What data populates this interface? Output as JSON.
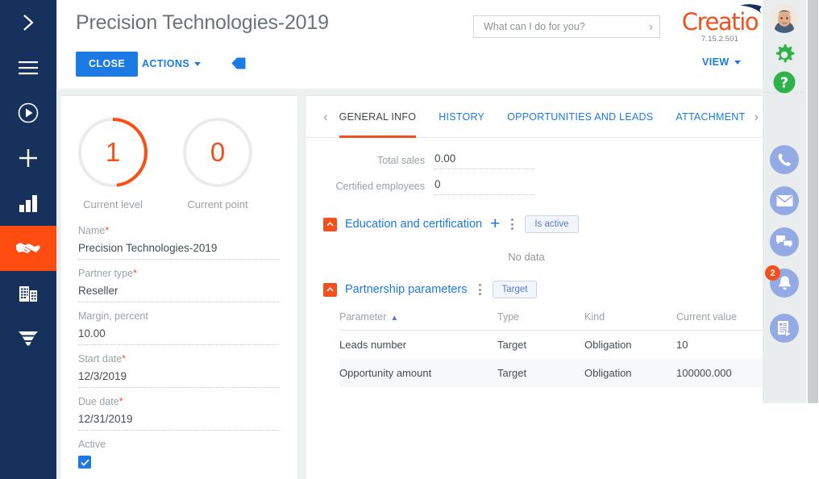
{
  "left_nav": {
    "items": [
      {
        "name": "expand-icon",
        "label": "Expand menu"
      },
      {
        "name": "hamburger-icon",
        "label": "Main menu"
      },
      {
        "name": "run-process-icon",
        "label": "Run process"
      },
      {
        "name": "add-icon",
        "label": "Add"
      },
      {
        "name": "analytics-icon",
        "label": "Dashboards"
      },
      {
        "name": "partners-icon",
        "label": "Partners",
        "active": true
      },
      {
        "name": "accounts-icon",
        "label": "Accounts"
      },
      {
        "name": "funnel-icon",
        "label": "Sales pipeline"
      }
    ]
  },
  "header": {
    "title": "Precision Technologies-2019",
    "close_label": "CLOSE",
    "actions_label": "ACTIONS",
    "view_label": "VIEW",
    "tag_icon": "tag-icon",
    "search": {
      "placeholder": "What can I do for you?",
      "value": "",
      "submit_icon": "chevron-right-icon"
    },
    "brand": {
      "name": "Creatio",
      "version": "7.15.2.501",
      "color": "#f4501e"
    }
  },
  "profile": {
    "gauges": [
      {
        "value": "1",
        "label": "Current level",
        "percent": 48,
        "color": "#ff4d12"
      },
      {
        "value": "0",
        "label": "Current point",
        "percent": 0,
        "color": "#ff4d12"
      }
    ],
    "fields": [
      {
        "label": "Name",
        "required": true,
        "value": "Precision Technologies-2019",
        "type": "text"
      },
      {
        "label": "Partner type",
        "required": true,
        "value": "Reseller",
        "type": "text"
      },
      {
        "label": "Margin, percent",
        "required": false,
        "value": "10.00",
        "type": "text"
      },
      {
        "label": "Start date",
        "required": true,
        "value": "12/3/2019",
        "type": "text"
      },
      {
        "label": "Due date",
        "required": true,
        "value": "12/31/2019",
        "type": "text"
      },
      {
        "label": "Active",
        "required": false,
        "value": "",
        "type": "checkbox",
        "checked": true
      }
    ]
  },
  "main": {
    "tabs": [
      {
        "label": "GENERAL INFO",
        "active": true
      },
      {
        "label": "HISTORY",
        "active": false
      },
      {
        "label": "OPPORTUNITIES AND LEADS",
        "active": false
      },
      {
        "label": "ATTACHMENTS",
        "active": false
      }
    ],
    "prev_tab_icon": "chevron-left-icon",
    "next_tab_icon": "chevron-right-icon",
    "general_info": [
      {
        "label": "Total sales",
        "value": "0.00"
      },
      {
        "label": "Certified employees",
        "value": "0"
      }
    ],
    "sections": [
      {
        "title": "Education and certification",
        "collapse_icon": "chevron-up-icon",
        "add_icon": "plus-icon",
        "menu_icon": "kebab-menu-icon",
        "chip": "Is active",
        "empty_text": "No data",
        "has_add": true
      },
      {
        "title": "Partnership parameters",
        "collapse_icon": "chevron-up-icon",
        "menu_icon": "kebab-menu-icon",
        "chip": "Target",
        "has_add": false
      }
    ],
    "table": {
      "columns": [
        "Parameter",
        "Type",
        "Kind",
        "Current value"
      ],
      "sorted_column": "Parameter",
      "sort_direction": "asc",
      "rows": [
        {
          "parameter": "Leads number",
          "type": "Target",
          "kind": "Obligation",
          "current_value": "10"
        },
        {
          "parameter": "Opportunity amount",
          "type": "Target",
          "kind": "Obligation",
          "current_value": "100000.000"
        }
      ]
    }
  },
  "right_rail": {
    "avatar": "user-avatar",
    "items": [
      {
        "name": "gear-icon",
        "label": "Settings",
        "style": "green"
      },
      {
        "name": "help-icon",
        "label": "Help",
        "style": "green"
      },
      {
        "name": "phone-icon",
        "label": "Calls",
        "style": "blue"
      },
      {
        "name": "email-icon",
        "label": "Email",
        "style": "blue"
      },
      {
        "name": "chat-icon",
        "label": "Chat",
        "style": "blue"
      },
      {
        "name": "notifications-icon",
        "label": "Notifications",
        "style": "blue",
        "badge": "2"
      },
      {
        "name": "feed-icon",
        "label": "Feed",
        "style": "blue"
      }
    ]
  }
}
